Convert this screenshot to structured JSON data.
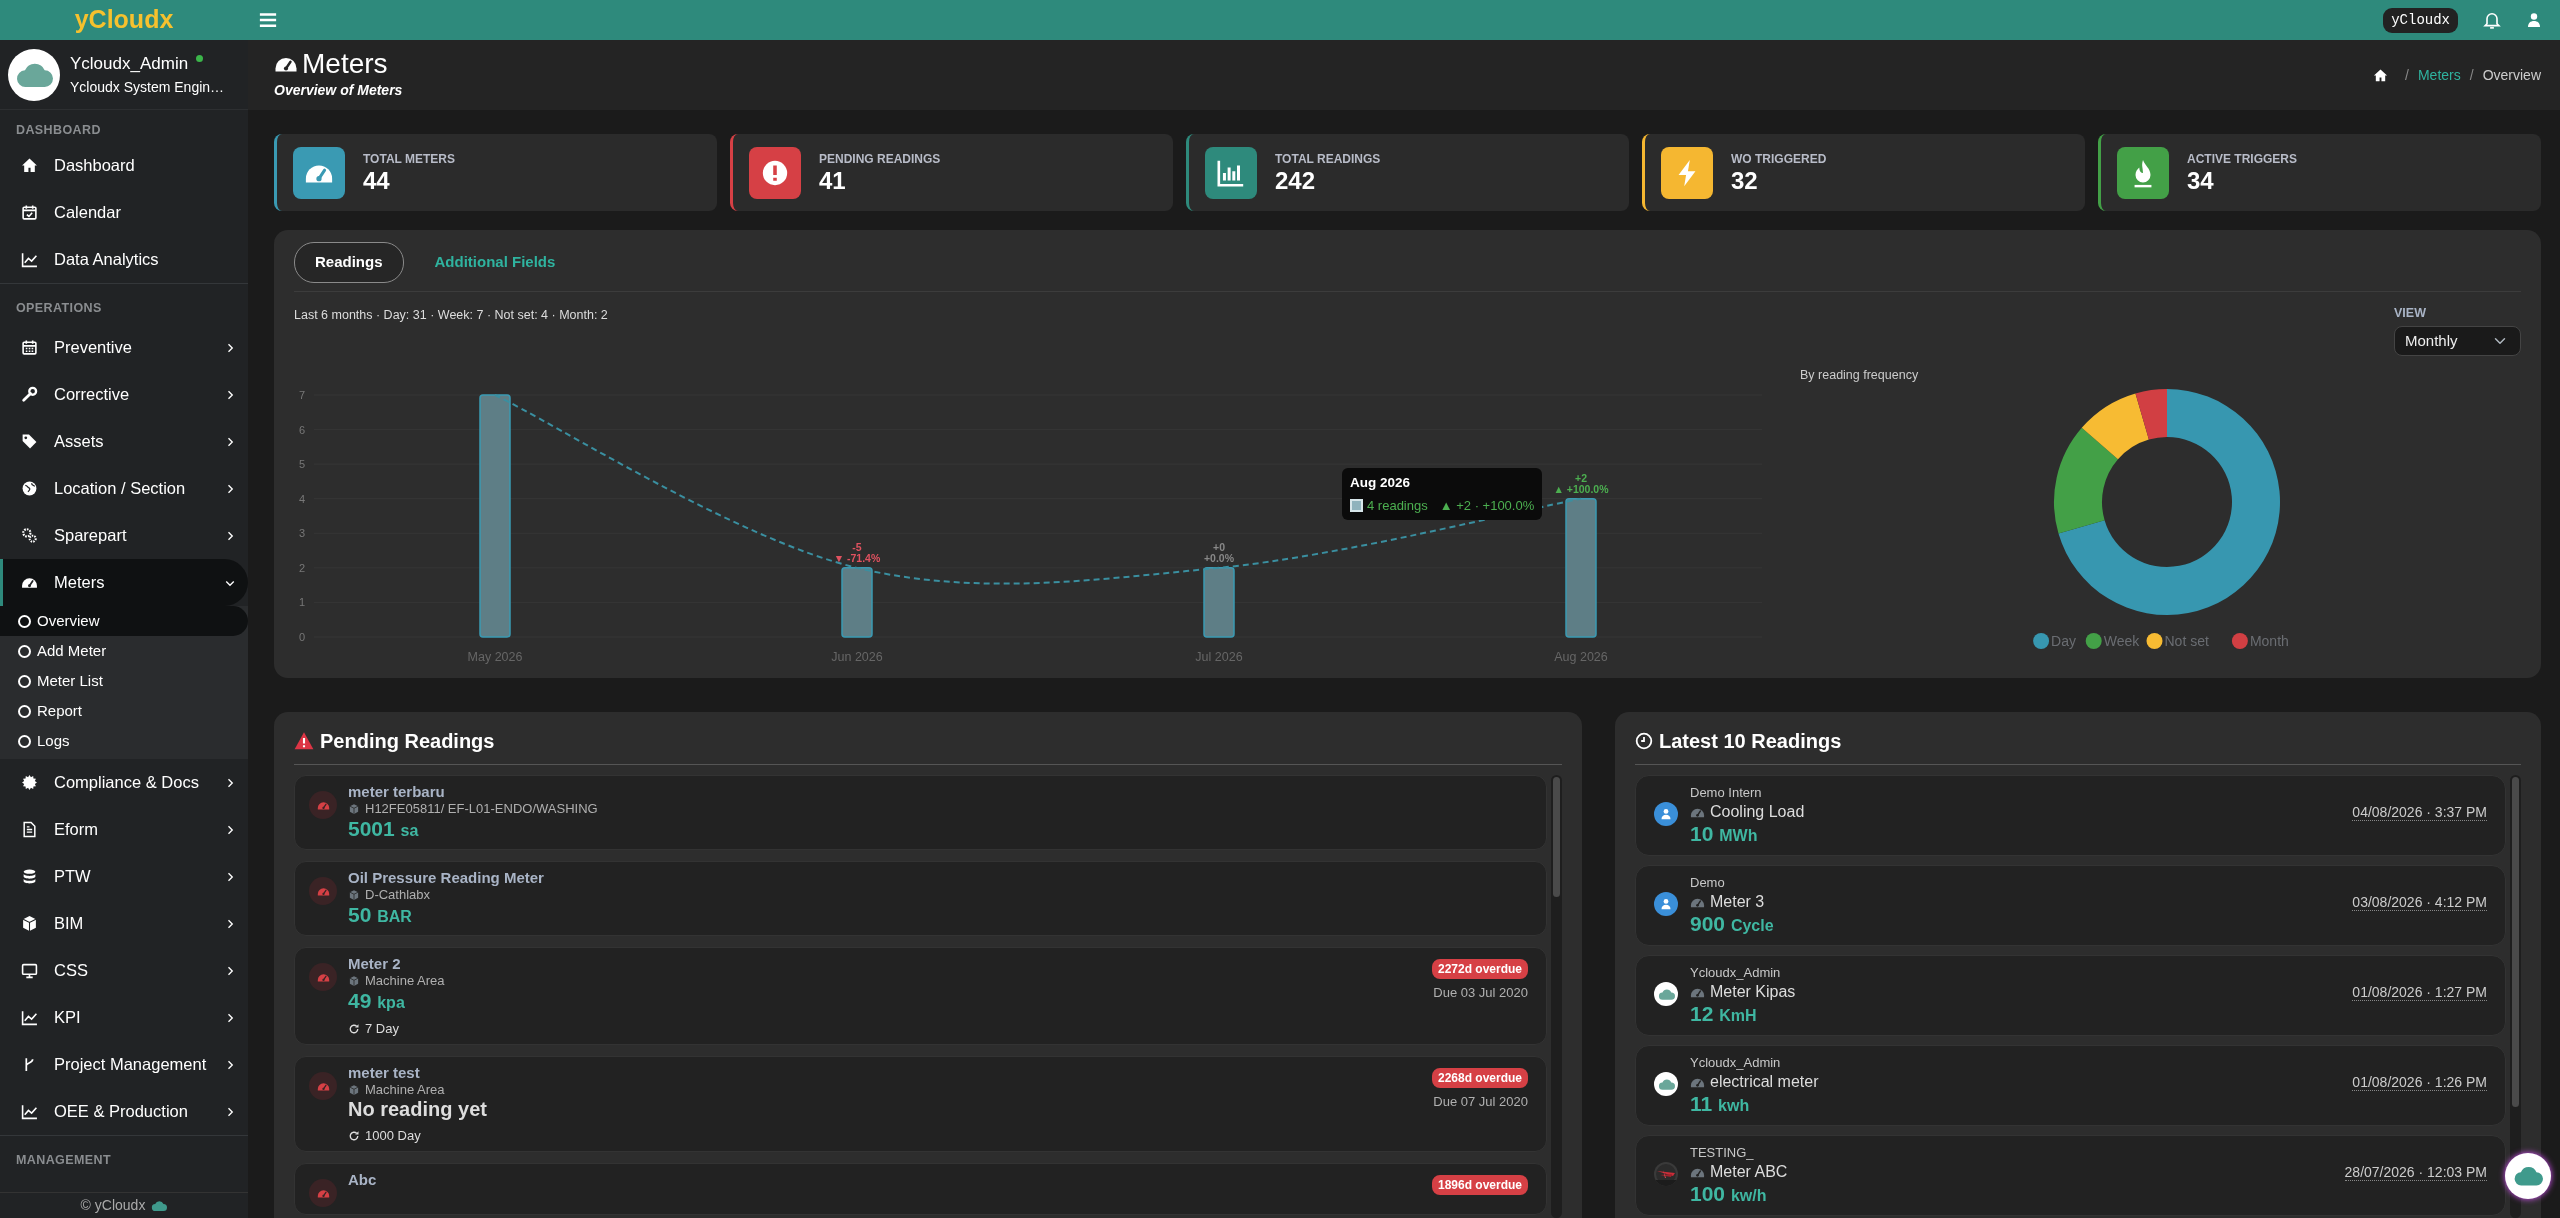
{
  "topbar": {
    "badge": "yCloudx"
  },
  "sidebar": {
    "brand": "yCloudx",
    "user": {
      "name": "Ycloudx_Admin",
      "role": "Ycloudx System Engin…",
      "online": true
    },
    "sections": [
      {
        "title": "DASHBOARD",
        "items": [
          {
            "label": "Dashboard",
            "selected": false
          },
          {
            "label": "Calendar",
            "selected": false
          },
          {
            "label": "Data Analytics",
            "selected": false
          }
        ]
      },
      {
        "title": "OPERATIONS",
        "items": [
          {
            "label": "Preventive",
            "selected": false,
            "expanded": false
          },
          {
            "label": "Corrective",
            "selected": false,
            "expanded": false
          },
          {
            "label": "Assets",
            "selected": false,
            "expanded": false
          },
          {
            "label": "Location / Section",
            "selected": false,
            "expanded": false
          },
          {
            "label": "Sparepart",
            "selected": false,
            "expanded": false
          },
          {
            "label": "Meters",
            "selected": true,
            "expanded": true,
            "children": [
              {
                "label": "Overview",
                "selected": true
              },
              {
                "label": "Add Meter",
                "selected": false
              },
              {
                "label": "Meter List",
                "selected": false
              },
              {
                "label": "Report",
                "selected": false
              },
              {
                "label": "Logs",
                "selected": false
              }
            ]
          },
          {
            "label": "Compliance & Docs",
            "selected": false,
            "expanded": false
          },
          {
            "label": "Eform",
            "selected": false,
            "expanded": false
          },
          {
            "label": "PTW",
            "selected": false,
            "expanded": false
          },
          {
            "label": "BIM",
            "selected": false,
            "expanded": false
          },
          {
            "label": "CSS",
            "selected": false,
            "expanded": false
          },
          {
            "label": "KPI",
            "selected": false,
            "expanded": false
          },
          {
            "label": "Project Management",
            "selected": false,
            "expanded": false
          },
          {
            "label": "OEE & Production",
            "selected": false,
            "expanded": false
          }
        ]
      },
      {
        "title": "MANAGEMENT"
      }
    ],
    "footer": "© yCloudx"
  },
  "page_header": {
    "title": "Meters",
    "subtitle": "Overview of Meters",
    "separator": "/",
    "breadcrumb": [
      {
        "label": "Meters",
        "active": false
      },
      {
        "label": "Overview",
        "active": true
      }
    ]
  },
  "stats": [
    {
      "label": "TOTAL METERS",
      "value": "44",
      "color": "#3a9ab3"
    },
    {
      "label": "PENDING READINGS",
      "value": "41",
      "color": "#d64045"
    },
    {
      "label": "TOTAL READINGS",
      "value": "242",
      "color": "#2e8a7c"
    },
    {
      "label": "WO TRIGGERED",
      "value": "32",
      "color": "#f5b731"
    },
    {
      "label": "ACTIVE TRIGGERS",
      "value": "34",
      "color": "#43a047"
    }
  ],
  "readings_card": {
    "tabs": [
      {
        "label": "Readings",
        "selected": true
      },
      {
        "label": "Additional Fields",
        "selected": false
      }
    ],
    "summary": "Last 6 months · Day: 31 · Week: 7 · Not set: 4 · Month: 2",
    "view": {
      "label": "VIEW",
      "value": "Monthly"
    },
    "trend_chart": {
      "annotation_marks": [
        {
          "color": "#e05260"
        },
        {
          "color": "#e05260"
        },
        {
          "color": "#888888"
        },
        {
          "color": "#888888"
        },
        {
          "color": "#4caf50"
        },
        {
          "color": "#4caf50"
        }
      ],
      "chart_data": {
        "type": "bar",
        "categories": [
          "May 2026",
          "Jun 2026",
          "Jul 2026",
          "Aug 2026"
        ],
        "values": [
          7,
          2,
          2,
          4
        ],
        "yticks": [
          0,
          1,
          2,
          3,
          4,
          5,
          6,
          7
        ],
        "ylim": [
          0,
          7
        ],
        "grid": true,
        "annotations": [
          {
            "x": "Jun 2026",
            "y": 2,
            "text": "-5"
          },
          {
            "x": "Jun 2026",
            "y": 2,
            "text": "▼ -71.4%"
          },
          {
            "x": "Jul 2026",
            "y": 2,
            "text": "+0"
          },
          {
            "x": "Jul 2026",
            "y": 2,
            "text": "+0.0%"
          },
          {
            "x": "Aug 2026",
            "y": 4,
            "text": "+2"
          },
          {
            "x": "Aug 2026",
            "y": 4,
            "text": "▲ +100.0%"
          }
        ]
      }
    },
    "tooltip": {
      "title": "Aug 2026",
      "value": "4 readings",
      "change": "▲ +2 · +100.0%"
    },
    "frequency_chart": {
      "slices": [
        {
          "color": "#3797b0"
        },
        {
          "color": "#43a047"
        },
        {
          "color": "#f7bb33"
        },
        {
          "color": "#d13f43"
        }
      ],
      "chart_data": {
        "type": "donut",
        "title": "By reading frequency",
        "categories": [
          "Day",
          "Week",
          "Not set",
          "Month"
        ],
        "values": [
          70.5,
          15.9,
          9.1,
          4.5
        ],
        "legend": true
      }
    }
  },
  "pending_readings": {
    "title": "Pending Readings",
    "items": [
      {
        "name": "meter terbaru",
        "location": "H12FE05811/ EF-L01-ENDO/WASHING",
        "value": "5001",
        "unit": "sa"
      },
      {
        "name": "Oil Pressure Reading Meter",
        "location": "D-Cathlabx",
        "value": "50",
        "unit": "BAR"
      },
      {
        "name": "Meter 2",
        "location": "Machine Area",
        "value": "49",
        "unit": "kpa",
        "frequency": "7 Day",
        "overdue": "2272d overdue",
        "due": "Due 03 Jul 2020"
      },
      {
        "name": "meter test",
        "location": "Machine Area",
        "note": "No reading yet",
        "frequency": "1000 Day",
        "overdue": "2268d overdue",
        "due": "Due 07 Jul 2020"
      },
      {
        "name": "Abc",
        "overdue": "1896d overdue"
      }
    ]
  },
  "latest_readings": {
    "title": "Latest 10 Readings",
    "items": [
      {
        "kind": "person",
        "user": "Demo Intern",
        "meter": "Cooling Load",
        "value": "10",
        "unit": "MWh",
        "time": "04/08/2026 · 3:37 PM"
      },
      {
        "kind": "person",
        "user": "Demo",
        "meter": "Meter 3",
        "value": "900",
        "unit": "Cycle",
        "time": "03/08/2026 · 4:12 PM"
      },
      {
        "kind": "cloud",
        "user": "Ycloudx_Admin",
        "meter": "Meter Kipas",
        "value": "12",
        "unit": "KmH",
        "time": "01/08/2026 · 1:27 PM"
      },
      {
        "kind": "cloud",
        "user": "Ycloudx_Admin",
        "meter": "electrical meter",
        "value": "11",
        "unit": "kwh",
        "time": "01/08/2026 · 1:26 PM"
      },
      {
        "user": "TESTING_",
        "meter": "Meter ABC",
        "value": "100",
        "unit": "kw/h",
        "time": "28/07/2026 · 12:03 PM"
      }
    ]
  }
}
